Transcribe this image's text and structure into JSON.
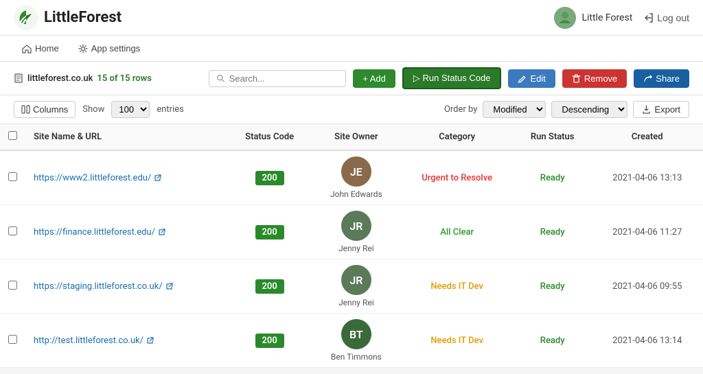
{
  "app": {
    "name": "LittleForest",
    "user": "Little Forest",
    "logout_label": "Log out"
  },
  "nav": {
    "home": "Home",
    "app_settings": "App settings"
  },
  "toolbar": {
    "site": "littleforest.co.uk",
    "row_count": "15 of 15 rows",
    "search_placeholder": "Search...",
    "add_label": "+ Add",
    "run_label": "▷ Run Status Code",
    "edit_label": "Edit",
    "remove_label": "Remove",
    "share_label": "Share"
  },
  "table_toolbar": {
    "columns_label": "Columns",
    "show_label": "Show",
    "entries_value": "100",
    "entries_label": "entries",
    "order_label": "Order by",
    "order_value": "Modified",
    "direction_value": "Descending",
    "export_label": "Export"
  },
  "table": {
    "headers": [
      "",
      "Site Name & URL",
      "Status Code",
      "Site Owner",
      "Category",
      "Run Status",
      "Created"
    ],
    "rows": [
      {
        "url": "https://www2.littleforest.edu/",
        "status_code": "200",
        "owner_name": "John Edwards",
        "owner_color": "#8a6a4a",
        "owner_initials": "JE",
        "category": "Urgent to Resolve",
        "category_class": "cat-urgent",
        "run_status": "Ready",
        "created": "2021-04-06 13:13"
      },
      {
        "url": "https://finance.littleforest.edu/",
        "status_code": "200",
        "owner_name": "Jenny Rei",
        "owner_color": "#5a7a5a",
        "owner_initials": "JR",
        "category": "All Clear",
        "category_class": "cat-allclear",
        "run_status": "Ready",
        "created": "2021-04-06 11:27"
      },
      {
        "url": "https://staging.littleforest.co.uk/",
        "status_code": "200",
        "owner_name": "Jenny Rei",
        "owner_color": "#5a7a5a",
        "owner_initials": "JR",
        "category": "Needs IT Dev",
        "category_class": "cat-needsit",
        "run_status": "Ready",
        "created": "2021-04-06 09:55"
      },
      {
        "url": "http://test.littleforest.co.uk/",
        "status_code": "200",
        "owner_name": "Ben Timmons",
        "owner_color": "#3a6a3a",
        "owner_initials": "BT",
        "category": "Needs IT Dev",
        "category_class": "cat-needsit",
        "run_status": "Ready",
        "created": "2021-04-06 13:14"
      }
    ]
  }
}
